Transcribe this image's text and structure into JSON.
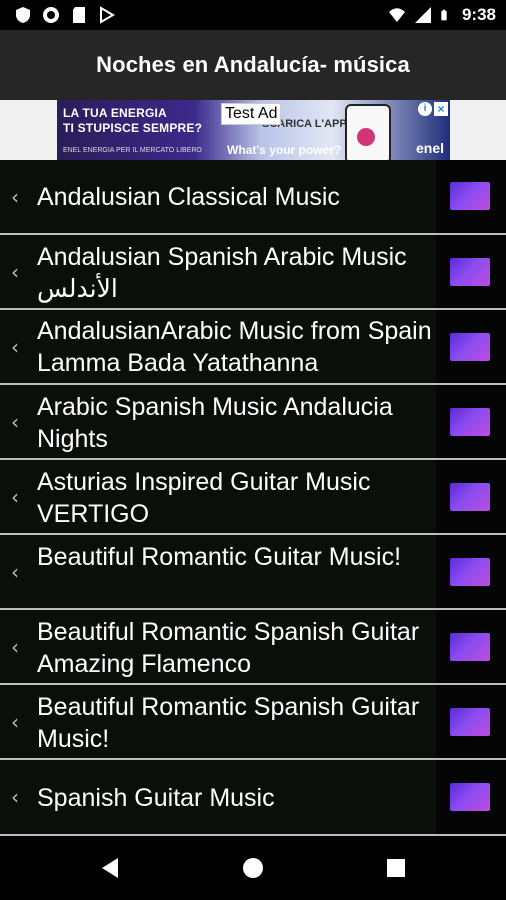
{
  "status_bar": {
    "time": "9:38",
    "left_icons": [
      "shield-icon",
      "record-icon",
      "sd-card-icon",
      "play-store-icon"
    ],
    "right_icons": [
      "wifi-icon",
      "signal-icon",
      "battery-icon"
    ]
  },
  "app_bar": {
    "title": "Noches en Andalucía- música"
  },
  "ad": {
    "label": "Test Ad",
    "headline_line1": "LA TUA ENERGIA",
    "headline_line2": "TI STUPISCE SEMPRE?",
    "small_text": "ENEL ENERGIA PER IL MERCATO LIBERO",
    "cta": "SCARICA L'APP",
    "tagline": "What's your power?",
    "brand": "enel",
    "info_icon": "info-icon",
    "close_icon": "close-icon"
  },
  "list": {
    "items": [
      {
        "title": "Andalusian Classical Music"
      },
      {
        "title": "Andalusian Spanish Arabic Music الأندلس"
      },
      {
        "title": "AndalusianArabic Music from Spain Lamma Bada Yatathanna"
      },
      {
        "title": "Arabic Spanish Music Andalucia Nights"
      },
      {
        "title": "Asturias Inspired Guitar Music VERTIGO"
      },
      {
        "title": "Beautiful Romantic Guitar Music!"
      },
      {
        "title": "Beautiful Romantic Spanish Guitar Amazing Flamenco"
      },
      {
        "title": "Beautiful Romantic Spanish Guitar Music!"
      },
      {
        "title": "Spanish Guitar Music"
      }
    ]
  },
  "nav_bar": {
    "icons": [
      "back-icon",
      "home-icon",
      "recents-icon"
    ]
  },
  "colors": {
    "app_bar_bg": "#262626",
    "list_bg": "#0a0f0a",
    "divider": "#bdbdbd",
    "thumb_accent": "#8a4cf0"
  }
}
